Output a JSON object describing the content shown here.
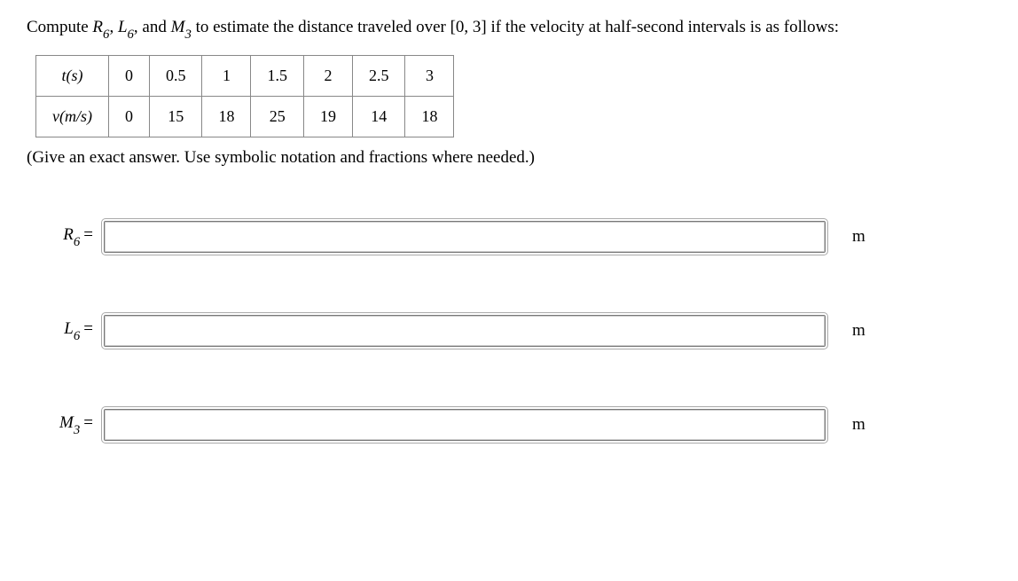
{
  "prompt_parts": {
    "pre": "Compute ",
    "r6": "R",
    "r6sub": "6",
    "sep1": ", ",
    "l6": "L",
    "l6sub": "6",
    "sep2": ", and ",
    "m3": "M",
    "m3sub": "3",
    "post": " to estimate the distance traveled over [0, 3] if the velocity at half-second intervals is as follows:"
  },
  "table": {
    "row1_label": "t(s)",
    "row2_label": "v(m/s)",
    "t": [
      "0",
      "0.5",
      "1",
      "1.5",
      "2",
      "2.5",
      "3"
    ],
    "v": [
      "0",
      "15",
      "18",
      "25",
      "19",
      "14",
      "18"
    ]
  },
  "note": "(Give an exact answer. Use symbolic notation and fractions where needed.)",
  "answers": {
    "r6": {
      "sym": "R",
      "sub": "6",
      "eq": "=",
      "value": "",
      "unit": "m"
    },
    "l6": {
      "sym": "L",
      "sub": "6",
      "eq": "=",
      "value": "",
      "unit": "m"
    },
    "m3": {
      "sym": "M",
      "sub": "3",
      "eq": "=",
      "value": "",
      "unit": "m"
    }
  },
  "chart_data": {
    "type": "table",
    "title": "Velocity at half-second intervals",
    "columns": [
      "t(s)",
      "v(m/s)"
    ],
    "rows": [
      [
        0,
        0
      ],
      [
        0.5,
        15
      ],
      [
        1,
        18
      ],
      [
        1.5,
        25
      ],
      [
        2,
        19
      ],
      [
        2.5,
        14
      ],
      [
        3,
        18
      ]
    ]
  }
}
